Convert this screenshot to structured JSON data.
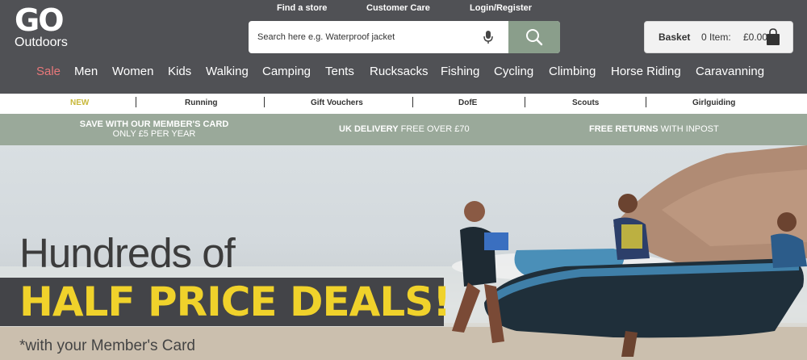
{
  "logo": {
    "go": "GO",
    "sub": "Outdoors"
  },
  "toplinks": [
    "Find a store",
    "Customer Care",
    "Login/Register"
  ],
  "search": {
    "placeholder": "Search here e.g. Waterproof jacket",
    "value": ""
  },
  "basket": {
    "label": "Basket",
    "items": "0 Item:",
    "total": "£0.00"
  },
  "nav": [
    "Sale",
    "Men",
    "Women",
    "Kids",
    "Walking",
    "Camping",
    "Tents",
    "Rucksacks",
    "Fishing",
    "Cycling",
    "Climbing",
    "Horse Riding",
    "Caravanning"
  ],
  "subnav": [
    "NEW",
    "Running",
    "Gift Vouchers",
    "DofE",
    "Scouts",
    "Girlguiding"
  ],
  "promo": {
    "member_line1": "SAVE WITH OUR MEMBER'S CARD",
    "member_line2": "ONLY £5 PER YEAR",
    "delivery_bold": "UK DELIVERY",
    "delivery_rest": " FREE OVER £70",
    "returns_bold": "FREE RETURNS",
    "returns_rest": " WITH INPOST"
  },
  "hero": {
    "headline": "Hundreds of",
    "banner": "HALF PRICE DEALS!",
    "footnote": "*with your Member's Card"
  },
  "colors": {
    "header": "#505155",
    "search_button": "#8a9e8b",
    "promo": "#9aa99a",
    "sale": "#e8787a",
    "banner_text": "#f0d22b",
    "new_label": "#c8b83a"
  },
  "icons": {
    "mic": "microphone-icon",
    "search": "search-icon",
    "basket": "shopping-bag-icon"
  }
}
